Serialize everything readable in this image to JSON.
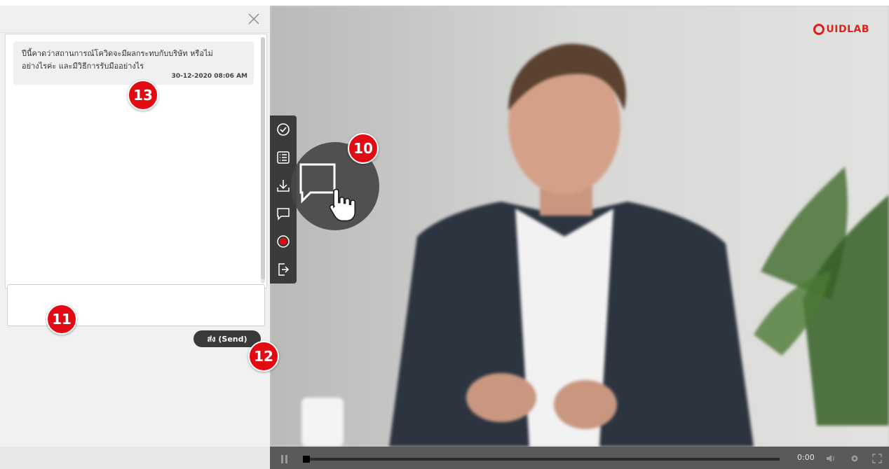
{
  "chat": {
    "messages": [
      {
        "line1": "ปีนี้คาดว่าสถานการณ์โควิดจะมีผลกระทบกับบริษัท หรือไม่",
        "line2": "อย่างไรค่ะ และมีวิธีการรับมืออย่างไร",
        "time": "30-12-2020 08:06 AM"
      }
    ],
    "input_value": "",
    "send_label": "ส่ง (Send)"
  },
  "brand": {
    "name": "UIDLAB",
    "color": "#e21b1b"
  },
  "toolbar": {
    "icons": [
      "check-circle-icon",
      "list-icon",
      "download-icon",
      "chat-icon",
      "record-icon",
      "exit-icon"
    ]
  },
  "player": {
    "time": "0:00",
    "progress": 0.0
  },
  "badges": [
    "13",
    "10",
    "11",
    "12"
  ],
  "colors": {
    "badge": "#e30b13",
    "toolbar": "#3b3b3b",
    "send_button": "#3a3a3a"
  }
}
